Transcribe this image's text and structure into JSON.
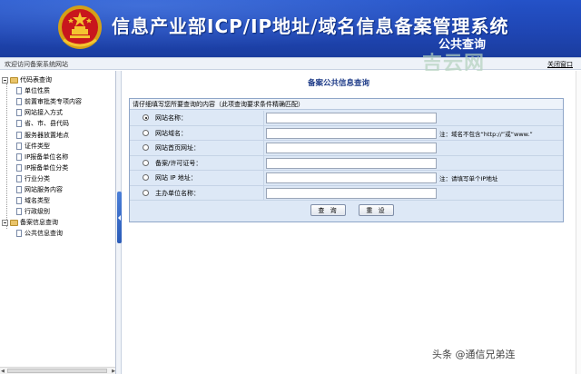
{
  "header": {
    "title": "信息产业部ICP/IP地址/域名信息备案管理系统",
    "subtitle": "公共查询"
  },
  "topbar": {
    "welcome": "欢迎访问备案系统网站",
    "close_label": "关闭窗口"
  },
  "watermark_logo": "吉云网",
  "sidebar": {
    "groups": [
      {
        "label": "代码表查询",
        "items": [
          "单位性质",
          "前置审批类专项内容",
          "网站接入方式",
          "省、市、县代码",
          "服务器放置地点",
          "证件类型",
          "IP报备单位名称",
          "IP报备单位分类",
          "行业分类",
          "网站服务内容",
          "域名类型",
          "行政级别"
        ]
      },
      {
        "label": "备案信息查询",
        "items": [
          "公共信息查询"
        ]
      }
    ]
  },
  "main": {
    "page_title": "备案公共信息查询",
    "form_header": "请仔细填写您所要查询的内容（此项查询要求条件精确匹配）",
    "rows": [
      {
        "label": "网站名称：",
        "value": "",
        "note": "",
        "checked": true
      },
      {
        "label": "网站域名：",
        "value": "",
        "note": "注：域名不包含“http://”或“www.”",
        "checked": false
      },
      {
        "label": "网站首页网址：",
        "value": "",
        "note": "",
        "checked": false
      },
      {
        "label": "备案/许可证号：",
        "value": "",
        "note": "",
        "checked": false
      },
      {
        "label": "网站 IP 地址：",
        "value": "",
        "note": "注：请填写单个IP地址",
        "checked": false
      },
      {
        "label": "主办单位名称：",
        "value": "",
        "note": "",
        "checked": false
      }
    ],
    "buttons": {
      "query": "查 询",
      "reset": "重 设"
    }
  },
  "footer_watermark": "头条 @通信兄弟连",
  "colors": {
    "header_blue": "#1f46b4",
    "panel_bg": "#dde8f6",
    "title_blue": "#1f3c88"
  }
}
